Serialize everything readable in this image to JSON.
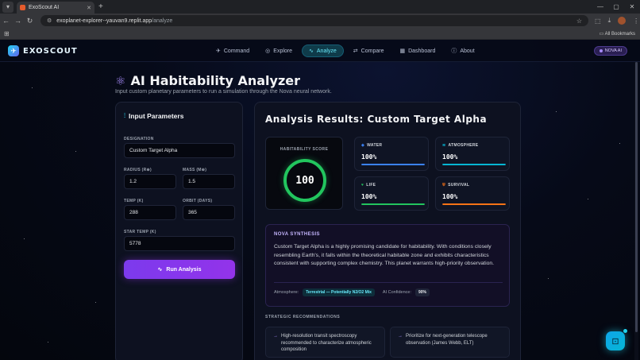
{
  "browser": {
    "tab_title": "ExoScout AI",
    "url_host": "exoplanet-explorer--yauvan9.replit.app",
    "url_path": "/analyze",
    "bookmarks_label": "All Bookmarks"
  },
  "nav": {
    "logo": "EXOSCOUT",
    "items": [
      {
        "label": "Command",
        "icon": "rocket-icon"
      },
      {
        "label": "Explore",
        "icon": "globe-icon"
      },
      {
        "label": "Analyze",
        "icon": "pulse-icon",
        "active": true
      },
      {
        "label": "Compare",
        "icon": "compare-icon"
      },
      {
        "label": "Dashboard",
        "icon": "grid-icon"
      },
      {
        "label": "About",
        "icon": "info-icon"
      }
    ],
    "badge": "NOVA AI"
  },
  "page": {
    "title": "AI Habitability Analyzer",
    "subtitle": "Input custom planetary parameters to run a simulation through the Nova neural network."
  },
  "inputs": {
    "heading": "Input Parameters",
    "designation_label": "DESIGNATION",
    "designation_value": "Custom Target Alpha",
    "radius_label": "RADIUS (R⊕)",
    "radius_value": "1.2",
    "mass_label": "MASS (M⊕)",
    "mass_value": "1.5",
    "temp_label": "TEMP (K)",
    "temp_value": "288",
    "orbit_label": "ORBIT (DAYS)",
    "orbit_value": "365",
    "star_temp_label": "STAR TEMP (K)",
    "star_temp_value": "5778",
    "run_label": "Run Analysis"
  },
  "results": {
    "title": "Analysis Results: Custom Target Alpha",
    "score_label": "HABITABILITY SCORE",
    "score": "100",
    "metrics": [
      {
        "label": "WATER",
        "value": "100%",
        "percent": 100,
        "color": "#3b82f6",
        "icon": "droplet-icon"
      },
      {
        "label": "ATMOSPHERE",
        "value": "100%",
        "percent": 100,
        "color": "#06b6d4",
        "icon": "wind-icon"
      },
      {
        "label": "LIFE",
        "value": "100%",
        "percent": 100,
        "color": "#22c55e",
        "icon": "heart-icon"
      },
      {
        "label": "SURVIVAL",
        "value": "100%",
        "percent": 100,
        "color": "#f97316",
        "icon": "shield-icon"
      }
    ],
    "synthesis_heading": "NOVA SYNTHESIS",
    "synthesis_text": "Custom Target Alpha is a highly promising candidate for habitability. With conditions closely resembling Earth's, it falls within the theoretical habitable zone and exhibits characteristics consistent with supporting complex chemistry. This planet warrants high-priority observation.",
    "atmosphere_label": "Atmosphere:",
    "atmosphere_value": "Terrestrial — Potentially N2/O2 Mix",
    "confidence_label": "AI Confidence:",
    "confidence_value": "90%",
    "recs_heading": "STRATEGIC RECOMMENDATIONS",
    "recommendations": [
      "High-resolution transit spectroscopy recommended to characterize atmospheric composition",
      "Prioritize for next-generation telescope observation (James Webb, ELT)"
    ]
  }
}
